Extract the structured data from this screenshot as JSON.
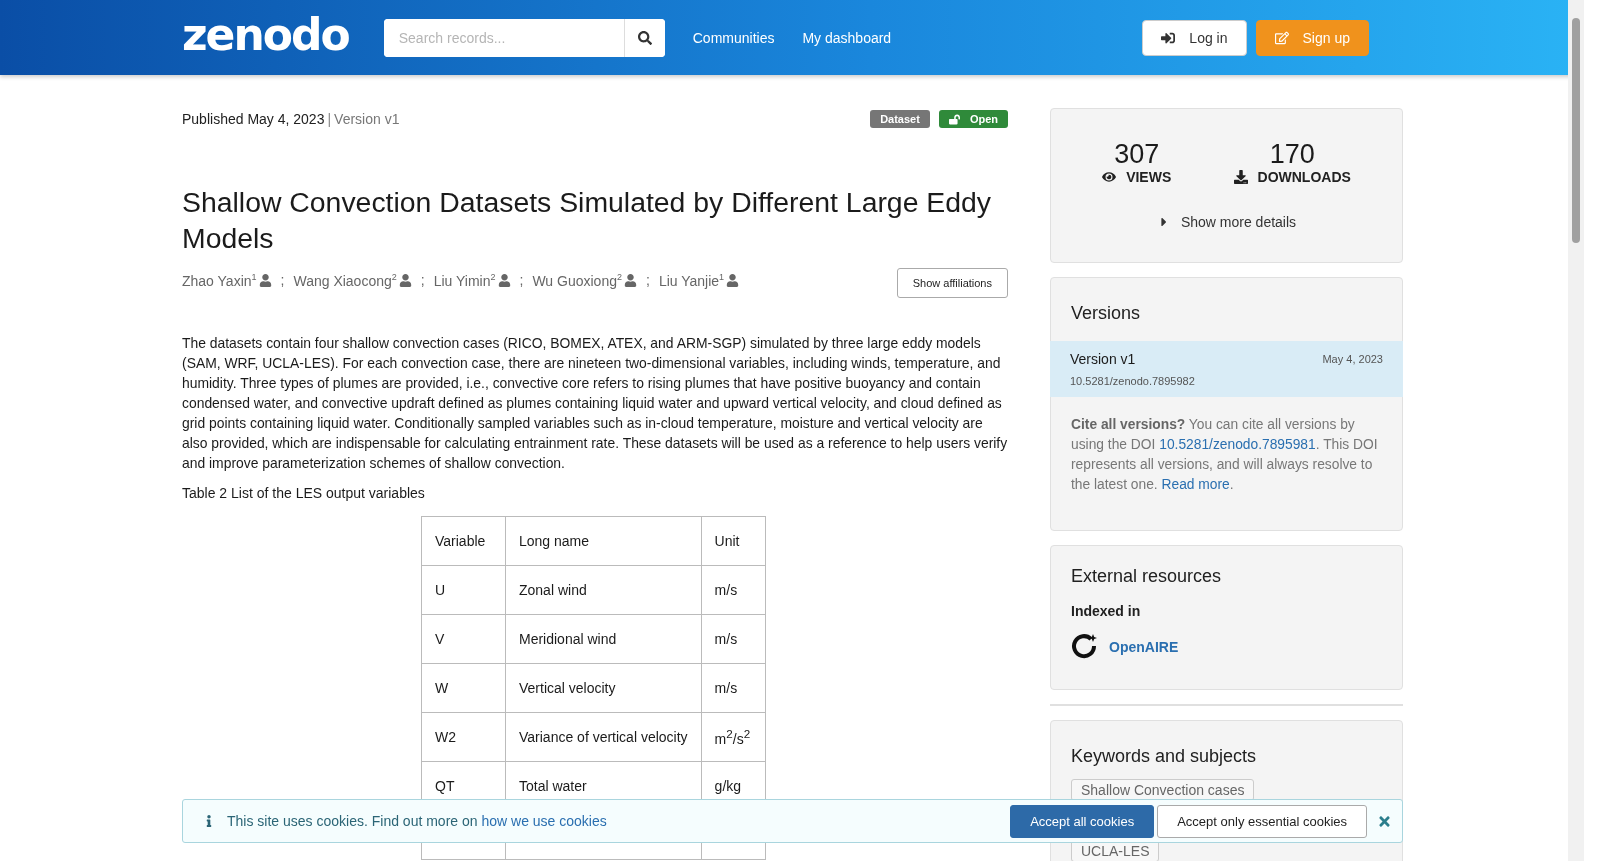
{
  "header": {
    "logo": "zenodo",
    "search": {
      "placeholder": "Search records..."
    },
    "nav": [
      "Communities",
      "My dashboard"
    ],
    "login": "Log in",
    "signup": "Sign up"
  },
  "record": {
    "published_label": "Published",
    "date": "May 4, 2023",
    "separator": "|",
    "version": "Version v1",
    "badges": [
      {
        "label": "Dataset",
        "kind": "type"
      },
      {
        "label": "Open",
        "kind": "access"
      }
    ],
    "title": "Shallow Convection Datasets Simulated by Different Large Eddy Models",
    "authors": [
      {
        "name": "Zhao Yaxin",
        "affiliation": "1"
      },
      {
        "name": "Wang Xiaocong",
        "affiliation": "2"
      },
      {
        "name": "Liu Yimin",
        "affiliation": "2"
      },
      {
        "name": "Wu Guoxiong",
        "affiliation": "2"
      },
      {
        "name": "Liu Yanjie",
        "affiliation": "1"
      }
    ],
    "author_separator": ";",
    "show_affiliations": "Show affiliations",
    "description": "The datasets contain four shallow convection cases (RICO, BOMEX, ATEX, and ARM-SGP) simulated by three large eddy models (SAM, WRF, UCLA-LES). For each convection case, there are nineteen two-dimensional variables, including winds, temperature, and humidity. Three types of plumes are provided, i.e., convective core refers to rising plumes that have positive buoyancy and contain condensed water, and convective updraft defined as plumes containing liquid water and upward vertical velocity, and cloud defined as grid points containing liquid water. Conditionally sampled variables such as in-cloud temperature, moisture and vertical velocity are also provided, which are indispensable for calculating entrainment rate. These datasets will be used as a reference to help users verify and improve parameterization schemes of shallow convection.",
    "table_caption": "Table 2 List of the LES output variables",
    "table": {
      "columns": [
        "Variable",
        "Long name",
        "Unit"
      ],
      "rows": [
        [
          "U",
          "Zonal wind",
          "m/s"
        ],
        [
          "V",
          "Meridional wind",
          "m/s"
        ],
        [
          "W",
          "Vertical velocity",
          "m/s"
        ],
        [
          "W2",
          "Variance of vertical velocity",
          "m$^{2}$/s$^{2}$"
        ],
        [
          "QT",
          "Total water",
          "g/kg"
        ]
      ]
    }
  },
  "sidebar": {
    "stats": [
      {
        "value": "307",
        "label": "VIEWS",
        "kind": "views"
      },
      {
        "value": "170",
        "label": "DOWNLOADS",
        "kind": "downloads"
      }
    ],
    "show_more": "Show more details",
    "versions": {
      "title": "Versions",
      "items": [
        {
          "label": "Version v1",
          "date": "May 4, 2023",
          "doi": "10.5281/zenodo.7895982",
          "selected": true
        }
      ],
      "cite": [
        {
          "kind": "text",
          "text": "**Cite all versions?** You can cite all versions by using the DOI "
        },
        {
          "kind": "link",
          "text": "10.5281/zenodo.7895981"
        },
        {
          "kind": "text",
          "text": ". This DOI represents all versions, and will always resolve to the latest one. "
        },
        {
          "kind": "link",
          "text": "Read more"
        },
        {
          "kind": "text",
          "text": "."
        }
      ]
    },
    "external": {
      "title": "External resources",
      "indexed_label": "Indexed in",
      "items": [
        {
          "name": "OpenAIRE"
        }
      ]
    },
    "keywords": {
      "title": "Keywords and subjects",
      "items": [
        "Shallow Convection cases",
        "UCLA-LES"
      ]
    }
  },
  "cookie": {
    "text": "This site uses cookies. Find out more on",
    "link": "how we use cookies",
    "accept_all": "Accept all cookies",
    "accept_essential": "Accept only essential cookies"
  }
}
